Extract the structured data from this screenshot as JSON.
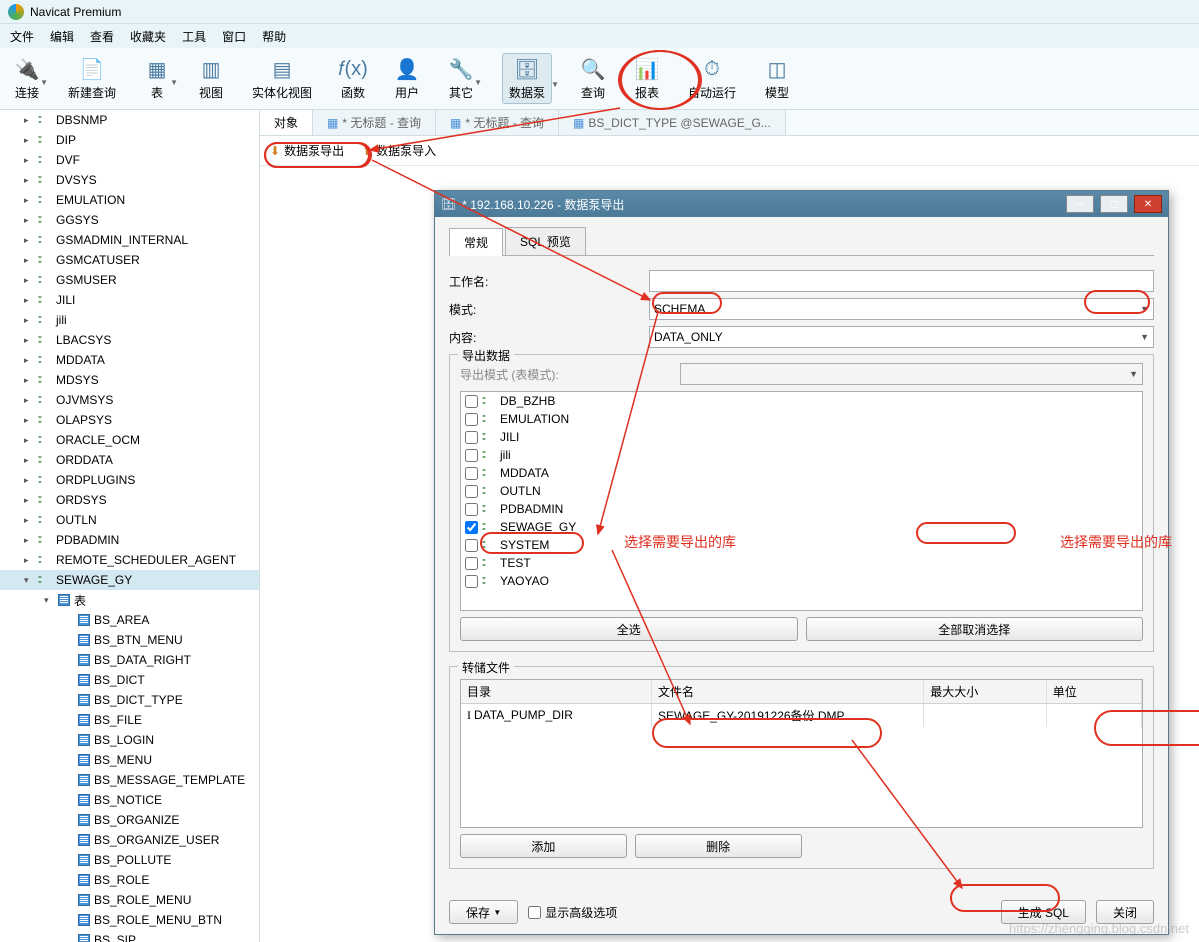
{
  "app": {
    "title": "Navicat Premium"
  },
  "menu": [
    "文件",
    "编辑",
    "查看",
    "收藏夹",
    "工具",
    "窗口",
    "帮助"
  ],
  "toolbar": [
    {
      "label": "连接",
      "icon": "plug",
      "hasDrop": true
    },
    {
      "label": "新建查询",
      "icon": "newq"
    },
    {
      "label": "表",
      "icon": "table",
      "hasDrop": true
    },
    {
      "label": "视图",
      "icon": "view"
    },
    {
      "label": "实体化视图",
      "icon": "mview"
    },
    {
      "label": "函数",
      "icon": "fx"
    },
    {
      "label": "用户",
      "icon": "user"
    },
    {
      "label": "其它",
      "icon": "wrench",
      "hasDrop": true
    },
    {
      "label": "数据泵",
      "icon": "pump",
      "selected": true,
      "hasDrop": true
    },
    {
      "label": "查询",
      "icon": "query"
    },
    {
      "label": "报表",
      "icon": "report"
    },
    {
      "label": "自动运行",
      "icon": "auto"
    },
    {
      "label": "模型",
      "icon": "model"
    }
  ],
  "tabs": {
    "t0": "对象",
    "t1": "* 无标题 - 查询",
    "t2": "* 无标题 - 查询",
    "t3": "BS_DICT_TYPE @SEWAGE_G..."
  },
  "subToolbar": {
    "export": "数据泵导出",
    "import": "数据泵导入"
  },
  "tree": {
    "schemas": [
      "DBSNMP",
      "DIP",
      "DVF",
      "DVSYS",
      "EMULATION",
      "GGSYS",
      "GSMADMIN_INTERNAL",
      "GSMCATUSER",
      "GSMUSER",
      "JILI",
      "jili",
      "LBACSYS",
      "MDDATA",
      "MDSYS",
      "OJVMSYS",
      "OLAPSYS",
      "ORACLE_OCM",
      "ORDDATA",
      "ORDPLUGINS",
      "ORDSYS",
      "OUTLN",
      "PDBADMIN",
      "REMOTE_SCHEDULER_AGENT"
    ],
    "selected": "SEWAGE_GY",
    "openNode": "表",
    "tables": [
      "BS_AREA",
      "BS_BTN_MENU",
      "BS_DATA_RIGHT",
      "BS_DICT",
      "BS_DICT_TYPE",
      "BS_FILE",
      "BS_LOGIN",
      "BS_MENU",
      "BS_MESSAGE_TEMPLATE",
      "BS_NOTICE",
      "BS_ORGANIZE",
      "BS_ORGANIZE_USER",
      "BS_POLLUTE",
      "BS_ROLE",
      "BS_ROLE_MENU",
      "BS_ROLE_MENU_BTN",
      "BS_SIP"
    ]
  },
  "dialog": {
    "title": "* 192.168.10.226 - 数据泵导出",
    "tabs": {
      "general": "常规",
      "sql": "SQL 预览"
    },
    "labels": {
      "jobName": "工作名:",
      "mode": "模式:",
      "content": "内容:",
      "exportGroup": "导出数据",
      "exportMode": "导出模式 (表模式):",
      "selectAll": "全选",
      "deselectAll": "全部取消选择",
      "dumpGroup": "转储文件",
      "colDir": "目录",
      "colFile": "文件名",
      "colMaxSize": "最大大小",
      "colUnit": "单位",
      "add": "添加",
      "delete": "删除",
      "save": "保存",
      "advanced": "显示高级选项",
      "genSql": "生成 SQL",
      "close": "关闭"
    },
    "values": {
      "jobName": "",
      "mode": "SCHEMA",
      "content": "DATA_ONLY",
      "dirValue": "DATA_PUMP_DIR",
      "fileValue": "SEWAGE_GY-20191226备份.DMP"
    },
    "schemaList": [
      {
        "name": "DB_BZHB",
        "checked": false
      },
      {
        "name": "EMULATION",
        "checked": false
      },
      {
        "name": "JILI",
        "checked": false
      },
      {
        "name": "jili",
        "checked": false
      },
      {
        "name": "MDDATA",
        "checked": false
      },
      {
        "name": "OUTLN",
        "checked": false
      },
      {
        "name": "PDBADMIN",
        "checked": false
      },
      {
        "name": "SEWAGE_GY",
        "checked": true
      },
      {
        "name": "SYSTEM",
        "checked": false
      },
      {
        "name": "TEST",
        "checked": false
      },
      {
        "name": "YAOYAO",
        "checked": false
      }
    ]
  },
  "annotation": {
    "chooseDb": "选择需要导出的库"
  }
}
